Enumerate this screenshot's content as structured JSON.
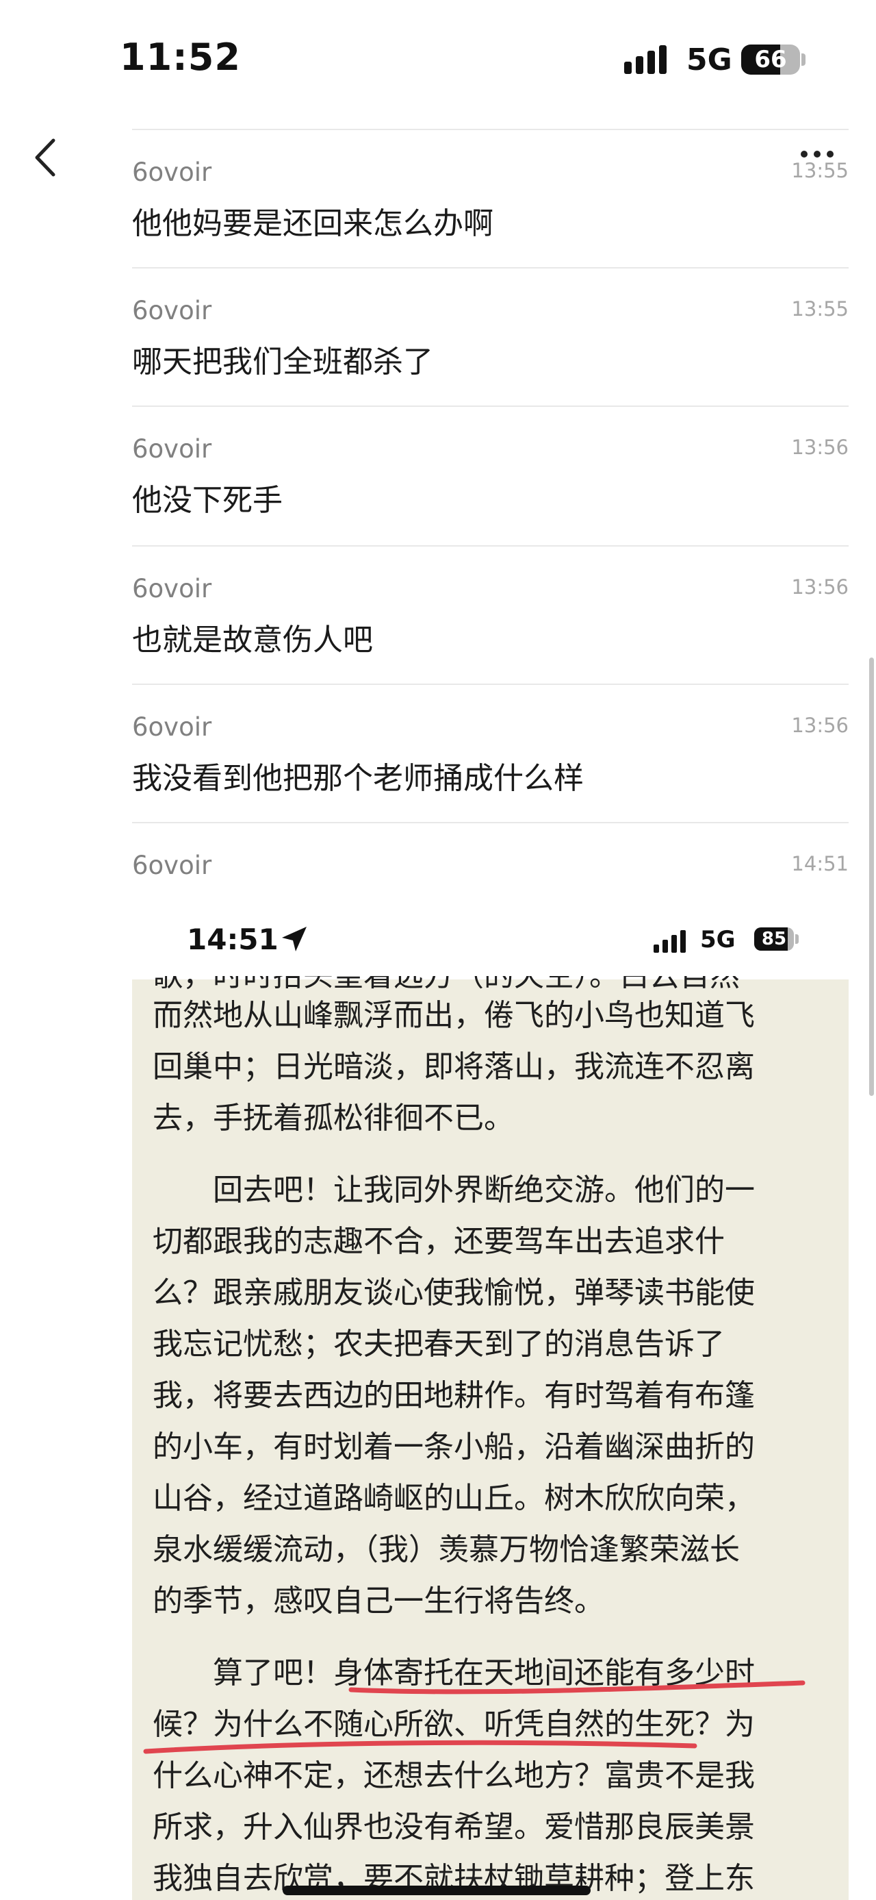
{
  "status_bar": {
    "time": "11:52",
    "network": "5G",
    "battery": "66",
    "battery_level_percent": 66
  },
  "chat": {
    "messages": [
      {
        "sender": "6ovoir",
        "time": "13:55",
        "text": "他他妈要是还回来怎么办啊"
      },
      {
        "sender": "6ovoir",
        "time": "13:55",
        "text": "哪天把我们全班都杀了"
      },
      {
        "sender": "6ovoir",
        "time": "13:56",
        "text": "他没下死手"
      },
      {
        "sender": "6ovoir",
        "time": "13:56",
        "text": "也就是故意伤人吧"
      },
      {
        "sender": "6ovoir",
        "time": "13:56",
        "text": "我没看到他把那个老师捅成什么样"
      },
      {
        "sender": "6ovoir",
        "time": "14:51",
        "text": ""
      }
    ]
  },
  "embedded_screenshot": {
    "status": {
      "time": "14:51",
      "network": "5G",
      "battery": "85",
      "battery_level_percent": 85
    },
    "cut_line": "歌，时时抬头望着远方（的天空）。白云自然",
    "lines": [
      "而然地从山峰飘浮而出，倦飞的小鸟也知道飞",
      "回巢中；日光暗淡，即将落山，我流连不忍离",
      "去，手抚着孤松徘徊不已。",
      "",
      "　　回去吧！让我同外界断绝交游。他们的一",
      "切都跟我的志趣不合，还要驾车出去追求什",
      "么？跟亲戚朋友谈心使我愉悦，弹琴读书能使",
      "我忘记忧愁；农夫把春天到了的消息告诉了",
      "我，将要去西边的田地耕作。有时驾着有布篷",
      "的小车，有时划着一条小船，沿着幽深曲折的",
      "山谷，经过道路崎岖的山丘。树木欣欣向荣，",
      "泉水缓缓流动，（我）羡慕万物恰逢繁荣滋长",
      "的季节，感叹自己一生行将告终。",
      "",
      "　　算了吧！身体寄托在天地间还能有多少时",
      "候？为什么不随心所欲、听凭自然的生死？为",
      "什么心神不定，还想去什么地方？富贵不是我",
      "所求，升入仙界也没有希望。爱惜那良辰美景",
      "我独自去欣赏，要不就扶杖锄草耕种；登上东"
    ],
    "highlight_color": "#e0454f"
  }
}
